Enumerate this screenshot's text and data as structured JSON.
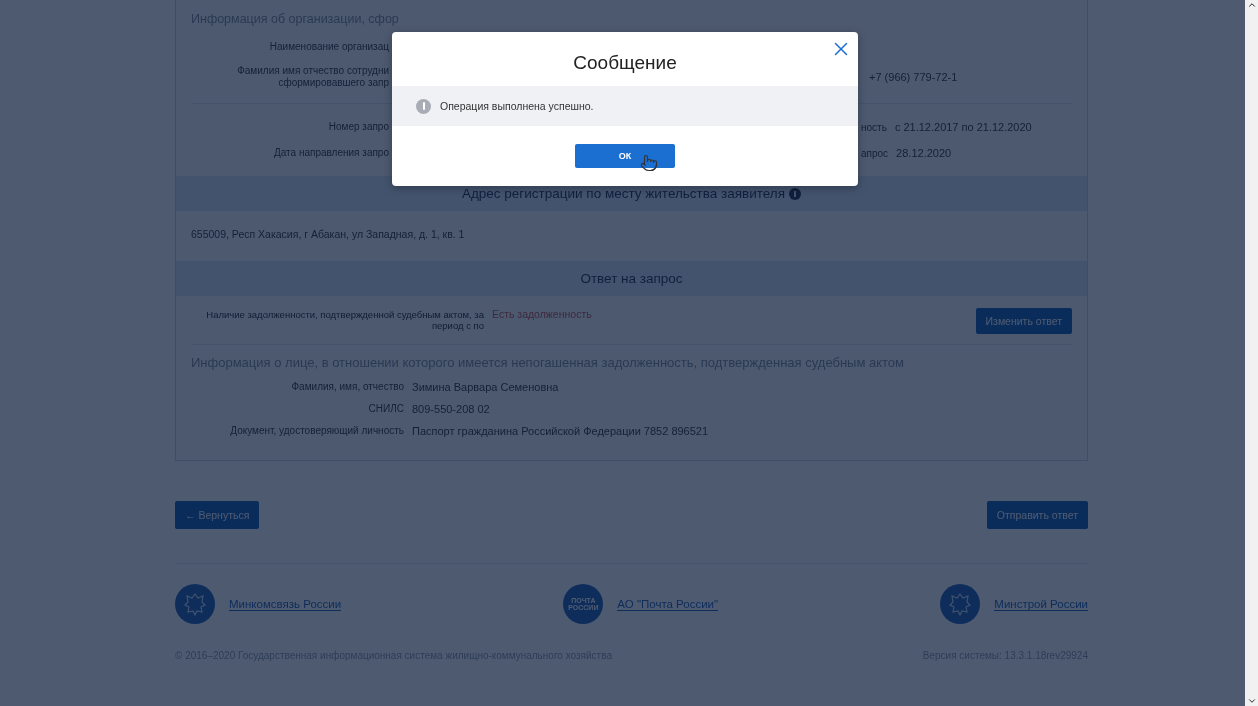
{
  "org_section": {
    "heading": "Информация об организации, сфор",
    "rows": [
      {
        "label": "Наименование организац"
      },
      {
        "label": "Фамилия имя отчество сотрудни\nсформировавшего запр",
        "value": "+7 (966) 779-72-1"
      },
      {
        "label": "Номер запро",
        "right_label": "ность",
        "value": "с 21.12.2017 по 21.12.2020"
      },
      {
        "label": "Дата направления запро",
        "right_label": "апрос",
        "value": "28.12.2020"
      }
    ]
  },
  "address_section": {
    "heading": "Адрес регистрации по месту жительства заявителя",
    "address": "655009, Респ Хакасия, г Абакан, ул Западная, д. 1, кв. 1"
  },
  "answer_section": {
    "heading": "Ответ на запрос",
    "question": "Наличие задолженности, подтвержденной судебным актом, за\nпериод с по",
    "answer": "Есть задолженность",
    "change_button": "Изменить ответ",
    "person_heading": "Информация о лице, в отношении которого имеется непогашенная задолженность, подтвержденная судебным актом",
    "person_rows": [
      {
        "label": "Фамилия, имя, отчество",
        "value": "Зимина Варвара Семеновна"
      },
      {
        "label": "СНИЛС",
        "value": "809-550-208 02"
      },
      {
        "label": "Документ, удостоверяющий личность",
        "value": "Паспорт гражданина Российской Федерации 7852 896521"
      }
    ]
  },
  "actions": {
    "back": "← Вернуться",
    "send": "Отправить ответ"
  },
  "partners": [
    {
      "name": "Минкомсвязь России"
    },
    {
      "logo_text": "ПОЧТА\nРОССИИ",
      "name": "АО \"Почта России\""
    },
    {
      "name": "Минстрой России"
    }
  ],
  "footer": {
    "copyright": "© 2016–2020 Государственная информационная система жилищно-коммунального хозяйства",
    "version": "Версия системы: 13.3.1.18rev29924"
  },
  "dialog": {
    "title": "Сообщение",
    "message": "Операция выполнена успешно.",
    "ok": "ОК"
  }
}
